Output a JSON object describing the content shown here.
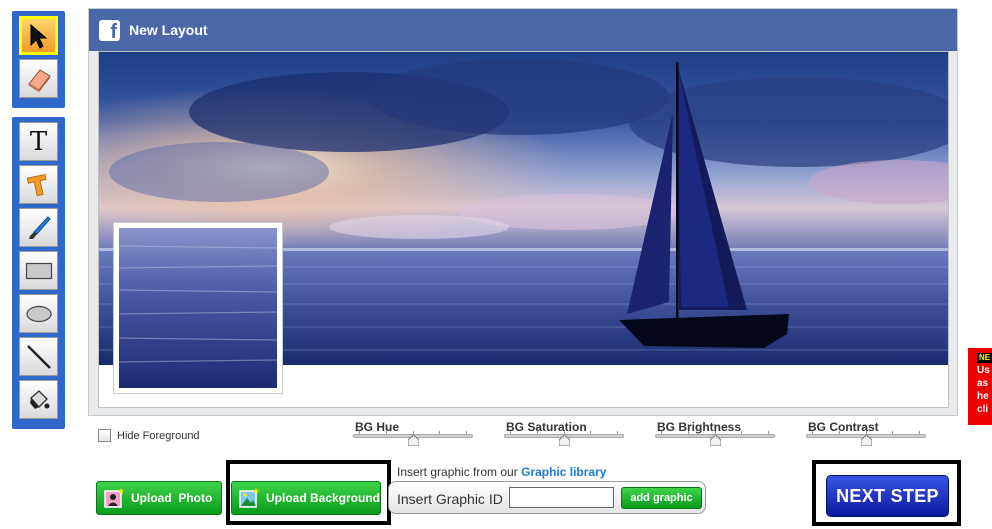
{
  "header": {
    "title": "New Layout"
  },
  "toolbar": {
    "top_tools": [
      {
        "icon": "arrow-pointer-icon",
        "selected": true
      },
      {
        "icon": "eraser-icon",
        "selected": false
      }
    ],
    "bottom_tools": [
      {
        "icon": "text-tool-icon",
        "glyph": "T"
      },
      {
        "icon": "text-effect-icon"
      },
      {
        "icon": "brush-icon"
      },
      {
        "icon": "rectangle-icon"
      },
      {
        "icon": "ellipse-icon"
      },
      {
        "icon": "line-icon"
      },
      {
        "icon": "paint-bucket-icon"
      }
    ]
  },
  "controls": {
    "hide_foreground_label": "Hide Foreground",
    "hide_foreground_checked": false,
    "sliders": [
      {
        "label": "BG Hue",
        "value": 0.5
      },
      {
        "label": "BG Saturation",
        "value": 0.5
      },
      {
        "label": "BG Brightness",
        "value": 0.5
      },
      {
        "label": "BG Contrast",
        "value": 0.5
      }
    ]
  },
  "actions": {
    "upload_photo": "Upload  Photo",
    "upload_background": "Upload Background",
    "library_prefix": "Insert graphic from our",
    "library_link": "Graphic library",
    "insert_label": "Insert Graphic ID",
    "insert_value": "",
    "add_graphic": "add graphic",
    "next_step": "NEXT STEP"
  },
  "promo": {
    "badge": "NE",
    "lines": [
      "Us",
      "as",
      "he",
      "cli"
    ]
  },
  "colors": {
    "toolbar_blue": "#2f68c9",
    "fb_header": "#4a68a8",
    "green_button": "#0a9a1b",
    "next_button": "#0b1a9c",
    "promo_red": "#ee0000"
  }
}
